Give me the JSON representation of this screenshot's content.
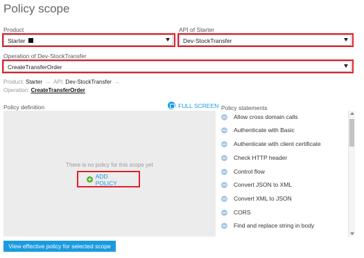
{
  "page": {
    "title": "Policy scope"
  },
  "product": {
    "label": "Product",
    "value": "Starter"
  },
  "api": {
    "label": "API of Starter",
    "value": "Dev-StockTransfer"
  },
  "operation": {
    "label": "Operation of Dev-StockTransfer",
    "value": "CreateTransferOrder"
  },
  "breadcrumb": {
    "product_label": "Product:",
    "product_value": "Starter",
    "api_label": "API:",
    "api_value": "Dev-StockTransfer",
    "operation_label": "Operation:",
    "operation_value": "CreateTransferOrder",
    "separator": "→"
  },
  "policy_definition": {
    "label": "Policy definition",
    "full_screen_label": "FULL SCREEN",
    "empty_message": "There is no policy for this scope yet",
    "add_policy_label": "ADD POLICY"
  },
  "policy_statements": {
    "label": "Policy statements",
    "items": [
      "Allow cross domain calls",
      "Authenticate with Basic",
      "Authenticate with client certificate",
      "Check HTTP header",
      "Control flow",
      "Convert JSON to XML",
      "Convert XML to JSON",
      "CORS",
      "Find and replace string in body"
    ]
  },
  "footer": {
    "view_effective_label": "View effective policy for selected scope"
  },
  "colors": {
    "accent": "#1a9be0",
    "highlight": "#e0202a",
    "add_icon": "#5ab22e",
    "statement_icon": "#a6c8e8"
  }
}
